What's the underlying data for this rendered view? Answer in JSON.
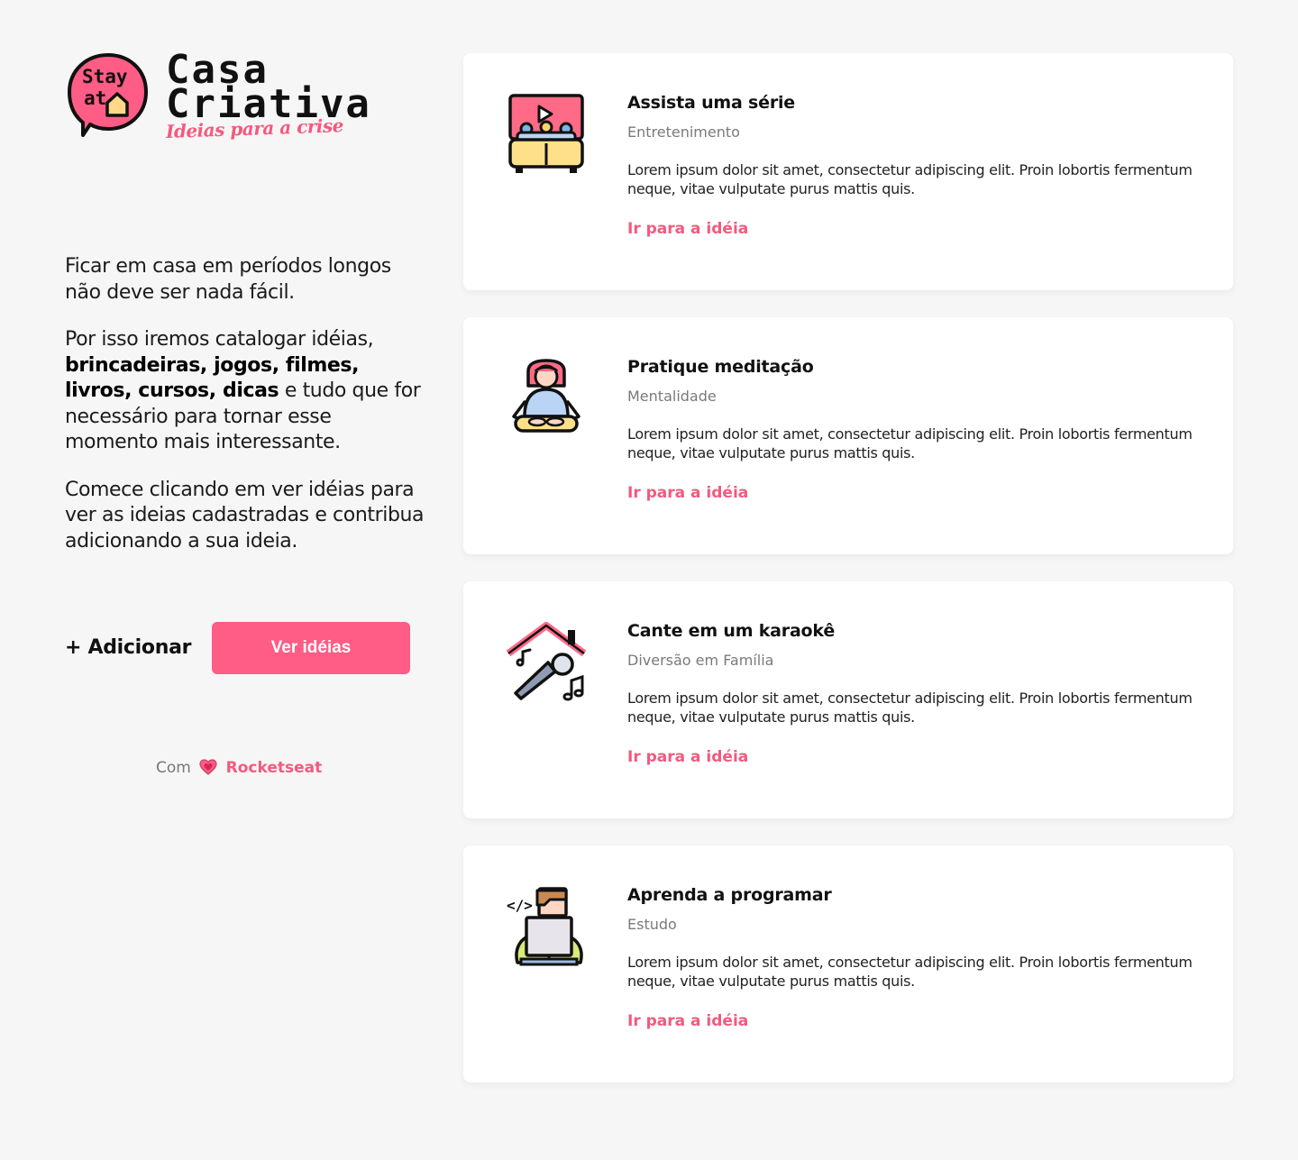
{
  "brand": {
    "badge_line1": "Stay",
    "badge_line2": "at",
    "title_line1": "Casa",
    "title_line2": "Criativa",
    "subtitle": "Ideias para a crise",
    "accent_color": "#ff5c86"
  },
  "intro": {
    "p1": "Ficar em casa em períodos longos não deve ser nada fácil.",
    "p2_start": "Por isso iremos catalogar idéias, ",
    "p2_bold": "brincadeiras, jogos, filmes, livros, cursos, dicas",
    "p2_end": " e tudo que for necessário para tornar esse momento mais interessante.",
    "p3": "Comece clicando em ver idéias para ver as ideias cadastradas e contribua adicionando a sua ideia."
  },
  "actions": {
    "add_label": "+ Adicionar",
    "view_label": "Ver idéias"
  },
  "footer": {
    "prefix": "Com",
    "heart_icon": "heart-icon",
    "brand": "Rocketseat"
  },
  "ideas": [
    {
      "icon": "tv-series-icon",
      "title": "Assista uma série",
      "category": "Entretenimento",
      "description": "Lorem ipsum dolor sit amet, consectetur adipiscing elit. Proin lobortis fermentum neque, vitae vulputate purus mattis quis.",
      "link": "Ir para a idéia"
    },
    {
      "icon": "meditation-icon",
      "title": "Pratique meditação",
      "category": "Mentalidade",
      "description": "Lorem ipsum dolor sit amet, consectetur adipiscing elit. Proin lobortis fermentum neque, vitae vulputate purus mattis quis.",
      "link": "Ir para a idéia"
    },
    {
      "icon": "karaoke-icon",
      "title": "Cante em um karaokê",
      "category": "Diversão em Família",
      "description": "Lorem ipsum dolor sit amet, consectetur adipiscing elit. Proin lobortis fermentum neque, vitae vulputate purus mattis quis.",
      "link": "Ir para a idéia"
    },
    {
      "icon": "programming-icon",
      "title": "Aprenda a programar",
      "category": "Estudo",
      "description": "Lorem ipsum dolor sit amet, consectetur adipiscing elit. Proin lobortis fermentum neque, vitae vulputate purus mattis quis.",
      "link": "Ir para a idéia"
    }
  ]
}
